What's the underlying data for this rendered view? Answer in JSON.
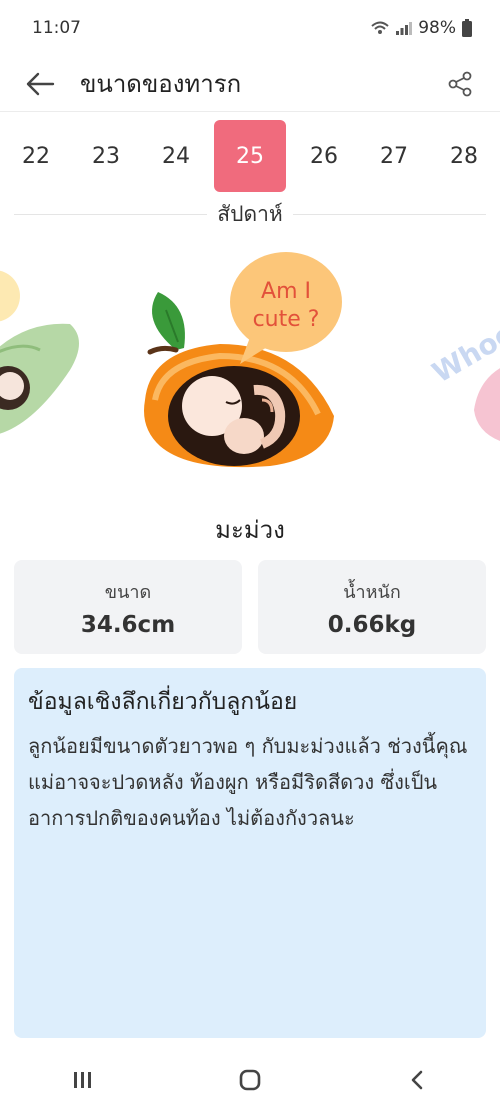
{
  "status": {
    "time": "11:07",
    "battery": "98%"
  },
  "header": {
    "title": "ขนาดของทารก"
  },
  "weeks": {
    "items": [
      "22",
      "23",
      "24",
      "25",
      "26",
      "27",
      "28"
    ],
    "selected": "25",
    "label": "สัปดาห์"
  },
  "illustration": {
    "speech": "Am I cute ?",
    "side_text": "Whoo"
  },
  "fruit": {
    "name": "มะม่วง"
  },
  "stats": {
    "size_label": "ขนาด",
    "size_value": "34.6cm",
    "weight_label": "น้ำหนัก",
    "weight_value": "0.66kg"
  },
  "info": {
    "title": "ข้อมูลเชิงลึกเกี่ยวกับลูกน้อย",
    "body": "ลูกน้อยมีขนาดตัวยาวพอ ๆ กับมะม่วงแล้ว ช่วงนี้คุณแม่อาจจะปวดหลัง ท้องผูก หรือมีริดสีดวง ซึ่งเป็นอาการปกติของคนท้อง ไม่ต้องกังวลนะ"
  },
  "colors": {
    "accent": "#f06b7d",
    "info_bg": "#ddeefc",
    "card_bg": "#f2f3f5",
    "mango": "#f5901e"
  }
}
